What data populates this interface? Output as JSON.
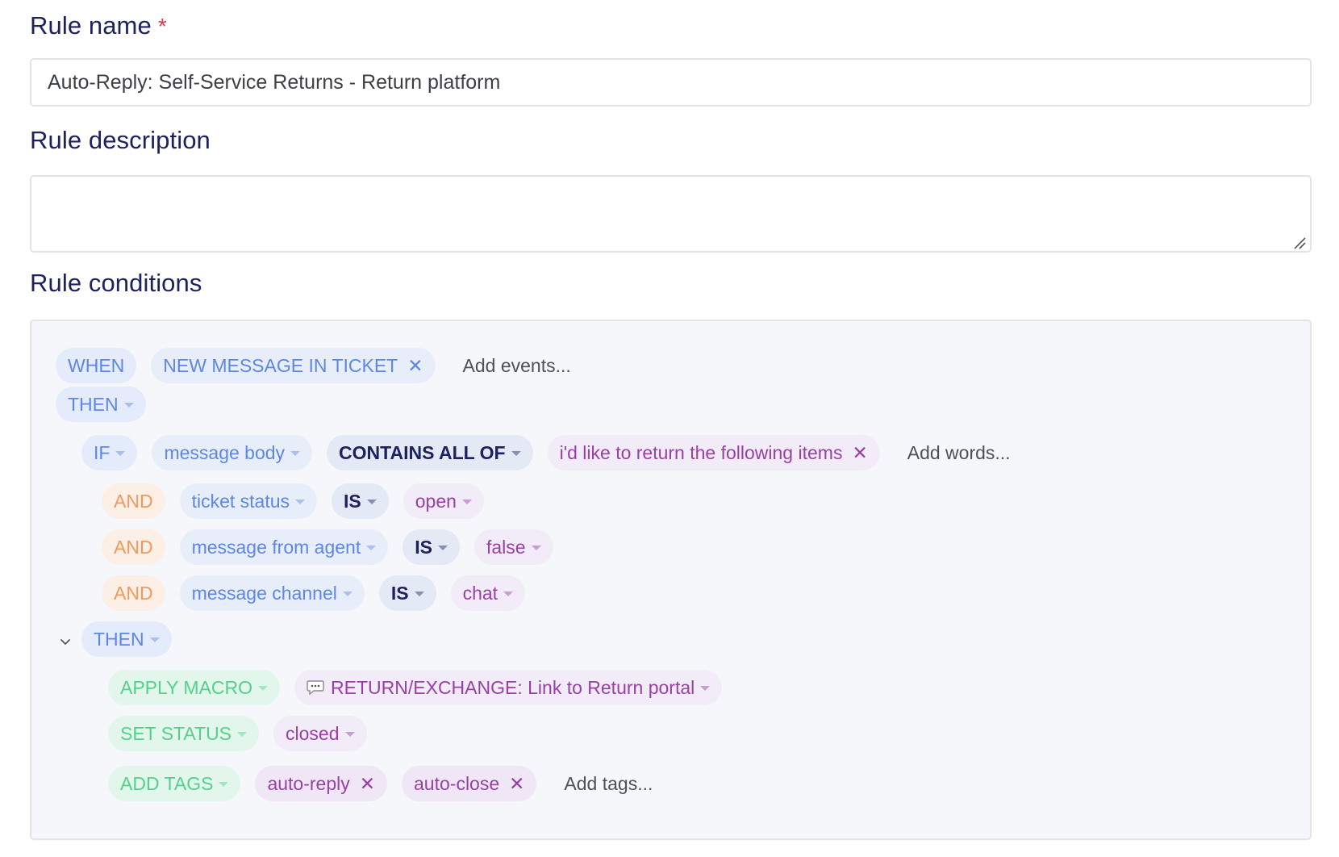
{
  "rule_name": {
    "label": "Rule name",
    "required_mark": "*",
    "value": "Auto-Reply: Self-Service Returns - Return platform"
  },
  "rule_description": {
    "label": "Rule description",
    "value": ""
  },
  "rule_conditions": {
    "label": "Rule conditions",
    "when": {
      "keyword": "WHEN",
      "event": "NEW MESSAGE IN TICKET",
      "add_placeholder": "Add events..."
    },
    "then_1": {
      "keyword": "THEN"
    },
    "if": {
      "keyword": "IF",
      "field": "message body",
      "operator": "CONTAINS ALL OF",
      "value": "i'd like to return the following items",
      "add_placeholder": "Add words..."
    },
    "and_conditions": [
      {
        "keyword": "AND",
        "field": "ticket status",
        "operator": "IS",
        "value": "open"
      },
      {
        "keyword": "AND",
        "field": "message from agent",
        "operator": "IS",
        "value": "false"
      },
      {
        "keyword": "AND",
        "field": "message channel",
        "operator": "IS",
        "value": "chat"
      }
    ],
    "then_2": {
      "keyword": "THEN"
    },
    "actions": {
      "apply_macro": {
        "label": "APPLY MACRO",
        "icon": "speech-bubble-icon",
        "value": "RETURN/EXCHANGE: Link to Return portal"
      },
      "set_status": {
        "label": "SET STATUS",
        "value": "closed"
      },
      "add_tags": {
        "label": "ADD TAGS",
        "tags": [
          "auto-reply",
          "auto-close"
        ],
        "add_placeholder": "Add tags..."
      }
    }
  },
  "colors": {
    "heading": "#1c2260",
    "required": "#e0364b",
    "keyword_blue": "#5d87e4",
    "value_purple": "#9a3fa6",
    "and_orange": "#ef9a5c",
    "action_green": "#55d08c"
  }
}
